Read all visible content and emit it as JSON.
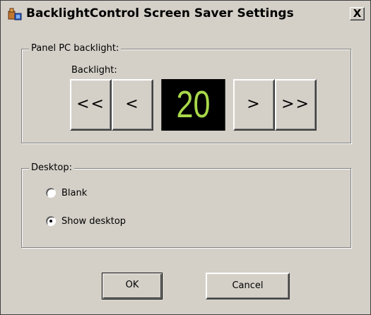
{
  "window": {
    "title": "BacklightControl Screen Saver Settings",
    "close_label": "X"
  },
  "panel_group": {
    "legend": "Panel PC backlight:",
    "backlight_label": "Backlight:",
    "fast_decrease_label": "<<",
    "decrease_label": "<",
    "value": "20",
    "increase_label": ">",
    "fast_increase_label": ">>",
    "value_color": "#a8d84a"
  },
  "desktop_group": {
    "legend": "Desktop:",
    "options": [
      {
        "label": "Blank",
        "selected": false
      },
      {
        "label": "Show desktop",
        "selected": true
      }
    ]
  },
  "buttons": {
    "ok_label": "OK",
    "cancel_label": "Cancel"
  }
}
